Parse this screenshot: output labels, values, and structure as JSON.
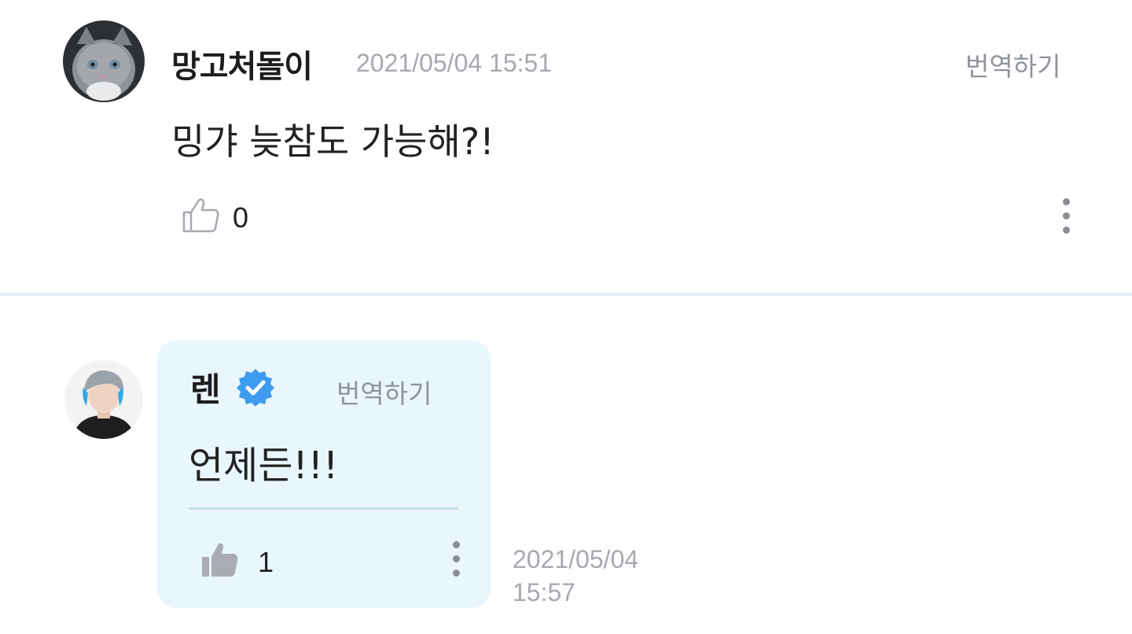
{
  "comment": {
    "author": "망고처돌이",
    "timestamp": "2021/05/04 15:51",
    "translate_label": "번역하기",
    "text": "밍갸 늦참도 가능해?!",
    "like_count": "0",
    "avatar_icon": "cat-avatar"
  },
  "reply": {
    "author": "렌",
    "verified_icon": "verified-badge-icon",
    "translate_label": "번역하기",
    "text": "언제든!!!",
    "like_count": "1",
    "liked": true,
    "timestamp_date": "2021/05/04",
    "timestamp_time": "15:57",
    "avatar_icon": "artist-avatar"
  },
  "colors": {
    "reply_bubble": "#eaf6fd",
    "verified_badge": "#3d9bf0",
    "meta_text": "#a6a9b0",
    "divider": "#e7eef5"
  }
}
